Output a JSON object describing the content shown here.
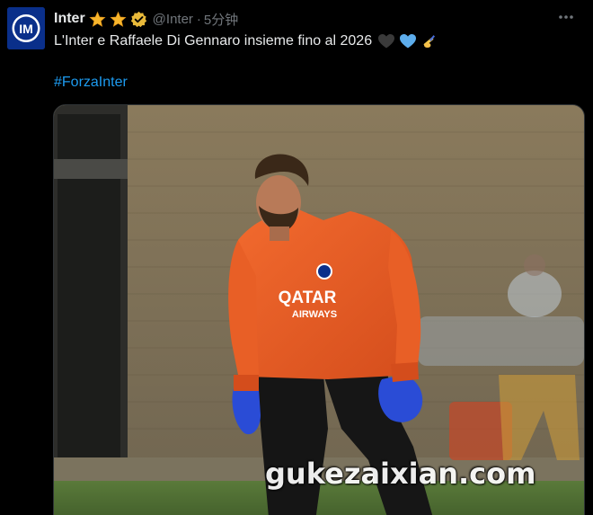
{
  "tweet": {
    "author_name": "Inter",
    "author_handle": "@Inter",
    "time_separator": "·",
    "timestamp": "5分钟",
    "text": "L'Inter e Raffaele Di Gennaro insieme fino al 2026",
    "hashtag": "#ForzaInter",
    "badges": [
      "star-icon",
      "star-icon",
      "verified-badge-icon"
    ],
    "emojis": [
      "black-heart-icon",
      "blue-heart-icon",
      "writing-hand-icon"
    ]
  },
  "media": {
    "jersey_sponsor_line1": "QATAR",
    "jersey_sponsor_line2": "AIRWAYS"
  },
  "watermark": {
    "text": "gukezaixian.com"
  },
  "colors": {
    "background": "#000000",
    "text": "#e7e9ea",
    "muted": "#71767b",
    "link": "#1d9bf0",
    "avatar_bg": "#0d3a9c",
    "jersey": "#ea5a24",
    "gloves": "#2a4cd6",
    "verified": "#e8b93a"
  }
}
